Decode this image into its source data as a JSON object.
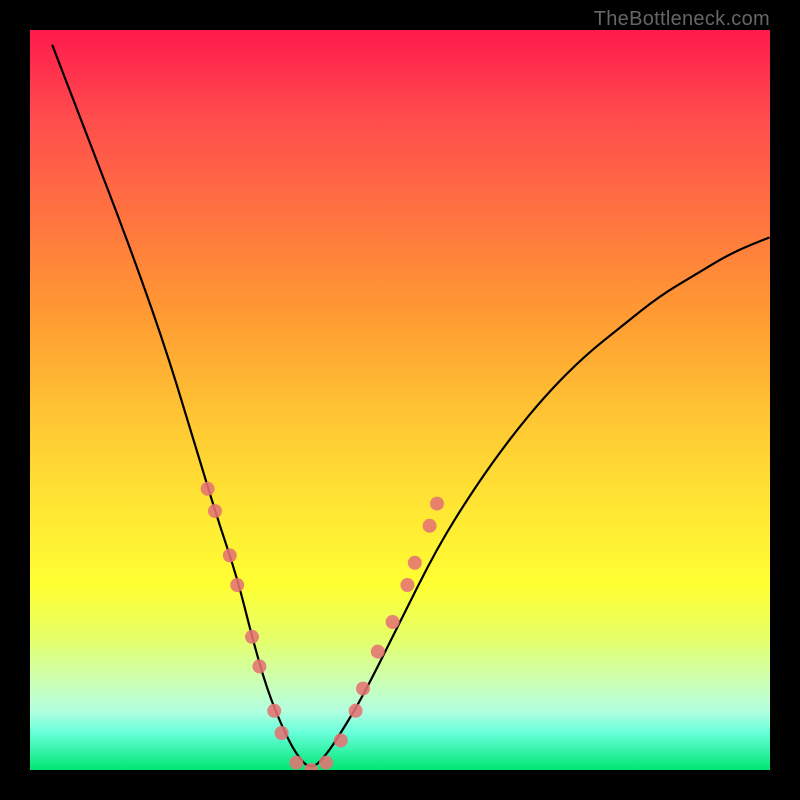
{
  "watermark": "TheBottleneck.com",
  "chart_data": {
    "type": "line",
    "title": "",
    "xlabel": "",
    "ylabel": "",
    "xlim": [
      0,
      100
    ],
    "ylim": [
      0,
      100
    ],
    "series": [
      {
        "name": "bottleneck-curve",
        "x": [
          3,
          8,
          13,
          18,
          22,
          25,
          28,
          30,
          32,
          34,
          36,
          38,
          40,
          42,
          45,
          50,
          55,
          60,
          65,
          70,
          75,
          80,
          85,
          90,
          95,
          100
        ],
        "values": [
          98,
          85,
          72,
          58,
          45,
          35,
          26,
          18,
          11,
          6,
          2,
          0,
          2,
          5,
          10,
          20,
          30,
          38,
          45,
          51,
          56,
          60,
          64,
          67,
          70,
          72
        ]
      }
    ],
    "markers": {
      "name": "dotted-segments",
      "color": "#e57373",
      "points": [
        {
          "x": 24,
          "y": 38
        },
        {
          "x": 25,
          "y": 35
        },
        {
          "x": 27,
          "y": 29
        },
        {
          "x": 28,
          "y": 25
        },
        {
          "x": 30,
          "y": 18
        },
        {
          "x": 31,
          "y": 14
        },
        {
          "x": 33,
          "y": 8
        },
        {
          "x": 34,
          "y": 5
        },
        {
          "x": 36,
          "y": 1
        },
        {
          "x": 38,
          "y": 0
        },
        {
          "x": 40,
          "y": 1
        },
        {
          "x": 42,
          "y": 4
        },
        {
          "x": 44,
          "y": 8
        },
        {
          "x": 45,
          "y": 11
        },
        {
          "x": 47,
          "y": 16
        },
        {
          "x": 49,
          "y": 20
        },
        {
          "x": 51,
          "y": 25
        },
        {
          "x": 52,
          "y": 28
        },
        {
          "x": 54,
          "y": 33
        },
        {
          "x": 55,
          "y": 36
        }
      ]
    }
  }
}
